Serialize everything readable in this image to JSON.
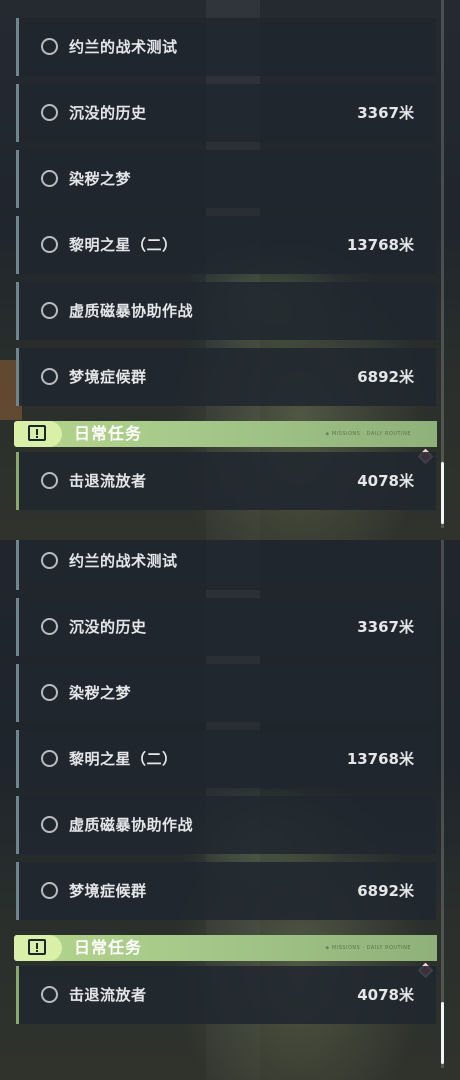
{
  "tasks": [
    {
      "name": "约兰的战术测试",
      "distance": ""
    },
    {
      "name": "沉没的历史",
      "distance": "3367米"
    },
    {
      "name": "染秽之梦",
      "distance": ""
    },
    {
      "name": "黎明之星（二）",
      "distance": "13768米"
    },
    {
      "name": "虚质磁暴协助作战",
      "distance": ""
    },
    {
      "name": "梦境症候群",
      "distance": "6892米"
    }
  ],
  "daily_section": {
    "title": "日常任务",
    "deco_text": "◈ MISSIONS · DAILY ROUTINE"
  },
  "daily_tasks": [
    {
      "name": "击退流放者",
      "distance": "4078米"
    }
  ],
  "colors": {
    "accent_green": "#b5d58a",
    "row_border": "#6f8690",
    "marker": "#e06a7c"
  },
  "icons": {
    "radio": "radio-circle-icon",
    "section": "alert-box-icon",
    "marker": "diamond-marker-icon"
  }
}
